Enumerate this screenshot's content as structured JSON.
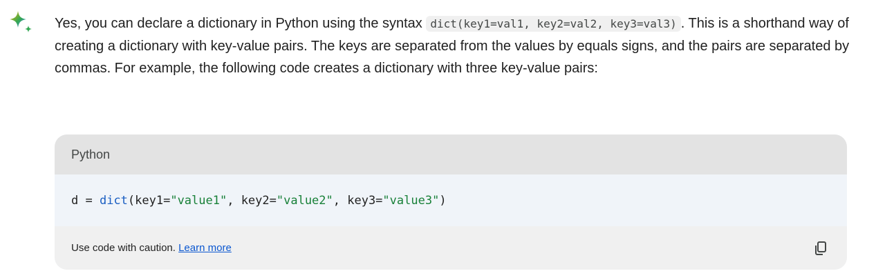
{
  "assistant": {
    "icon": "gemini-sparkle-icon",
    "message": {
      "text_before_code": "Yes, you can declare a dictionary in Python using the syntax ",
      "inline_code": "dict(key1=val1, key2=val2, key3=val3)",
      "text_after_code": ". This is a shorthand way of creating a dictionary with key-value pairs. The keys are separated from the values by equals signs, and the pairs are separated by commas. For example, the following code creates a dictionary with three key-value pairs:"
    }
  },
  "code_block": {
    "language": "Python",
    "code": {
      "part1": "d = ",
      "builtin": "dict",
      "part2": "(key1=",
      "str1": "\"value1\"",
      "part3": ", key2=",
      "str2": "\"value2\"",
      "part4": ", key3=",
      "str3": "\"value3\"",
      "part5": ")"
    },
    "footer": {
      "caution_text": "Use code with caution. ",
      "learn_more_label": "Learn more"
    },
    "copy_icon": "copy-icon"
  },
  "colors": {
    "link": "#0b57d0",
    "builtin": "#1a5ec2",
    "string": "#188038",
    "header_bg": "#e3e3e3",
    "code_bg": "#f0f4f9"
  }
}
